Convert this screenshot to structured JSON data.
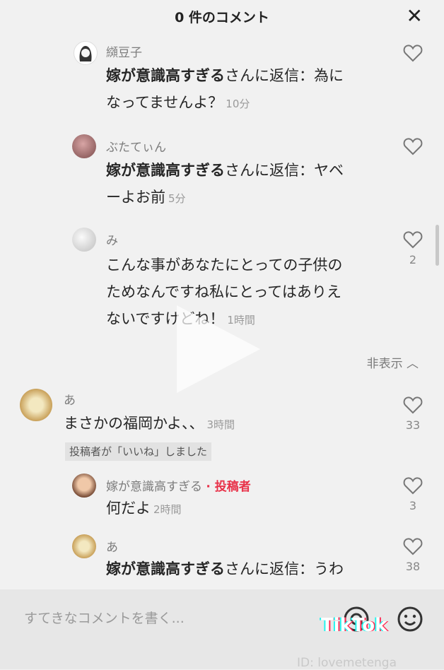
{
  "header": {
    "title": "0 件のコメント",
    "close_icon": "✕"
  },
  "comments": [
    {
      "username": "纐豆子",
      "reply_prefix": "嫁が意識高すぎる",
      "reply_suffix": "さんに返信：為に",
      "text_line2": "なってませんよ？",
      "time": "10分"
    },
    {
      "username": "ぶたてぃん",
      "reply_prefix": "嫁が意識高すぎる",
      "reply_suffix": "さんに返信：ヤベ",
      "text_line2": "ーよお前",
      "time": "5分"
    },
    {
      "username": "み",
      "text_line1": "こんな事があなたにとっての子供の",
      "text_line2": "ためなんですね私にとってはありえ",
      "text_line3": "ないですけどね！",
      "time": "1時間",
      "like_count": "2"
    },
    {
      "username": "あ",
      "text": "まさかの福岡かよ、、",
      "time": "3時間",
      "like_count": "33"
    },
    {
      "username": "嫁が意識高すぎる",
      "author_badge": "· 投稿者",
      "text": "何だよ",
      "time": "2時間",
      "like_count": "3"
    },
    {
      "username": "あ",
      "reply_prefix": "嫁が意識高すぎる",
      "reply_suffix": "さんに返信：うわ",
      "like_count": "38"
    }
  ],
  "hide_replies": "非表示 ︿",
  "creator_liked": "投稿者が「いいね」しました",
  "input_placeholder": "すてきなコメントを書く...",
  "watermark": {
    "logo": "TikTok",
    "id": "ID: lovemetenga"
  },
  "icons": {
    "like": "heart-outline-icon",
    "mention": "at-sign-icon",
    "emoji": "emoji-icon"
  }
}
